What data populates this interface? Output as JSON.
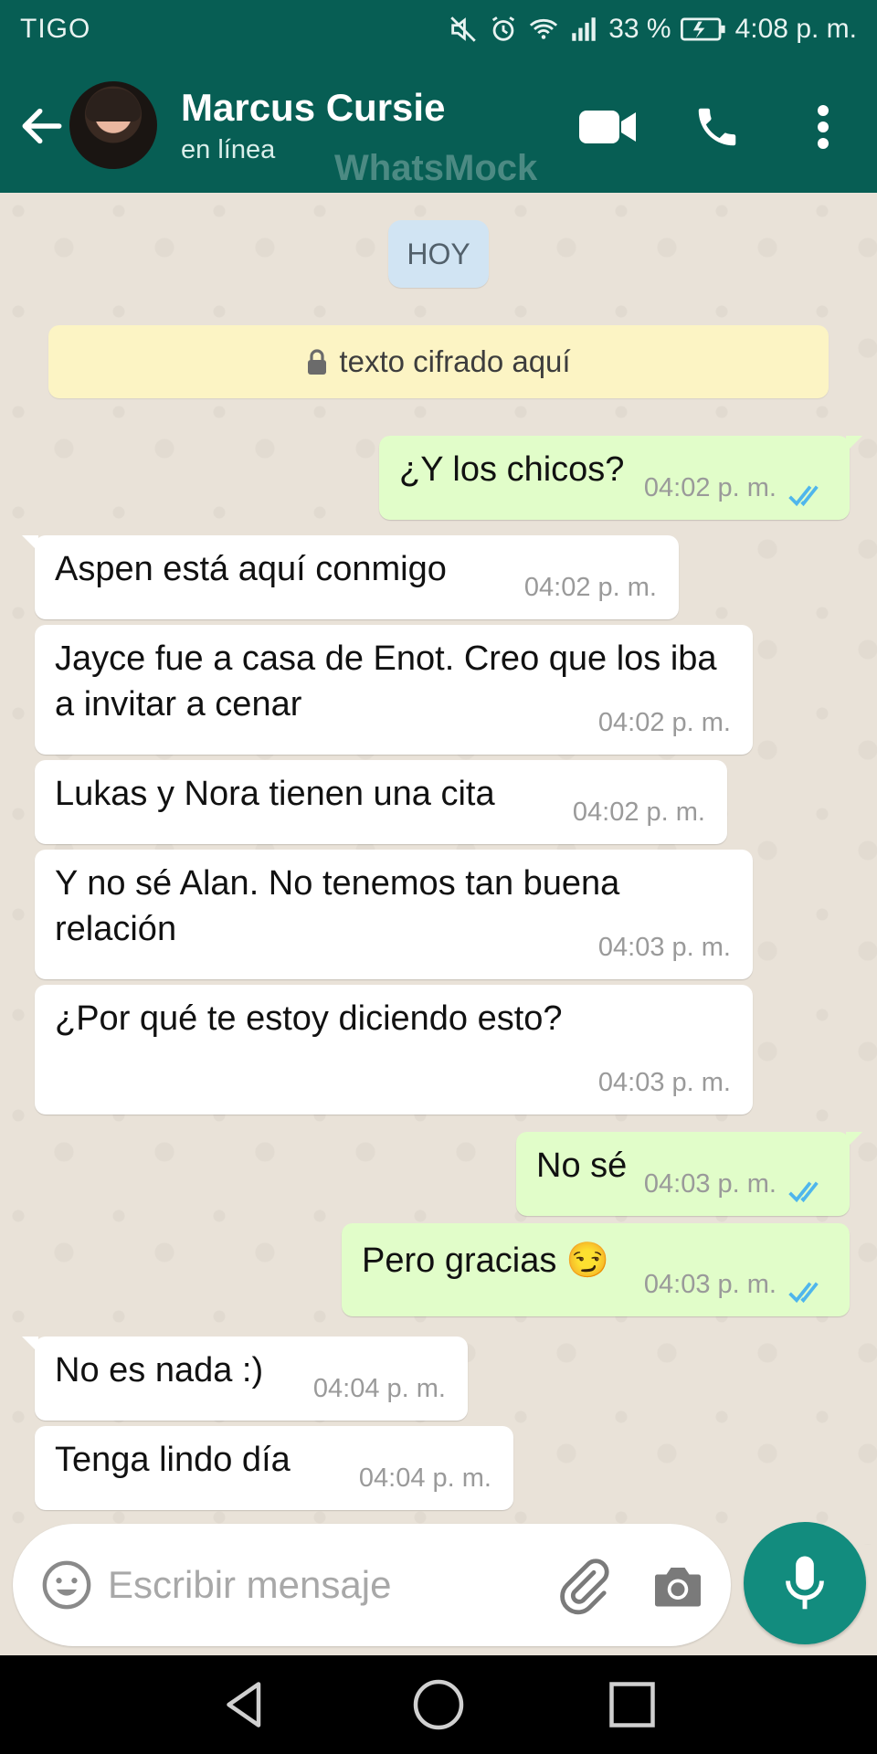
{
  "status_bar": {
    "carrier": "TIGO",
    "battery_percent": "33 %",
    "time": "4:08 p. m.",
    "icons": [
      "mute-icon",
      "alarm-icon",
      "wifi-icon",
      "signal-icon",
      "battery-charging-icon"
    ]
  },
  "header": {
    "contact_name": "Marcus Cursie",
    "status": "en línea",
    "watermark": "WhatsMock",
    "icons": [
      "back-arrow-icon",
      "video-call-icon",
      "phone-icon",
      "more-vert-icon"
    ]
  },
  "chat": {
    "date_chip": "HOY",
    "encryption_notice": "texto cifrado aquí",
    "messages": [
      {
        "direction": "out",
        "text": "¿Y los chicos?",
        "time": "04:02 p. m.",
        "read": true
      },
      {
        "direction": "in",
        "text": "Aspen está aquí conmigo",
        "time": "04:02 p. m."
      },
      {
        "direction": "in",
        "text": "Jayce fue a casa de Enot. Creo que los iba a invitar a cenar",
        "time": "04:02 p. m."
      },
      {
        "direction": "in",
        "text": "Lukas y Nora tienen una cita",
        "time": "04:02 p. m."
      },
      {
        "direction": "in",
        "text": "Y no sé Alan. No tenemos tan buena relación",
        "time": "04:03 p. m."
      },
      {
        "direction": "in",
        "text": "¿Por qué te estoy diciendo esto?",
        "time": "04:03 p. m."
      },
      {
        "direction": "out",
        "text": "No sé",
        "time": "04:03 p. m.",
        "read": true
      },
      {
        "direction": "out",
        "text": "Pero gracias 😏",
        "time": "04:03 p. m.",
        "read": true
      },
      {
        "direction": "in",
        "text": "No es nada :)",
        "time": "04:04 p. m."
      },
      {
        "direction": "in",
        "text": "Tenga lindo día",
        "time": "04:04 p. m."
      }
    ]
  },
  "composer": {
    "placeholder": "Escribir mensaje",
    "value": "",
    "icons": [
      "emoji-icon",
      "attach-icon",
      "camera-icon",
      "mic-icon"
    ]
  },
  "nav_bar": {
    "icons": [
      "nav-back-icon",
      "nav-home-icon",
      "nav-recents-icon"
    ]
  },
  "colors": {
    "header": "#075e54",
    "outgoing_bubble": "#e1fdc9",
    "incoming_bubble": "#ffffff",
    "read_ticks": "#4fb6ec",
    "mic_button": "#128c7e",
    "encryption_banner": "#fcf4c4",
    "date_chip": "#d1e4f3"
  }
}
